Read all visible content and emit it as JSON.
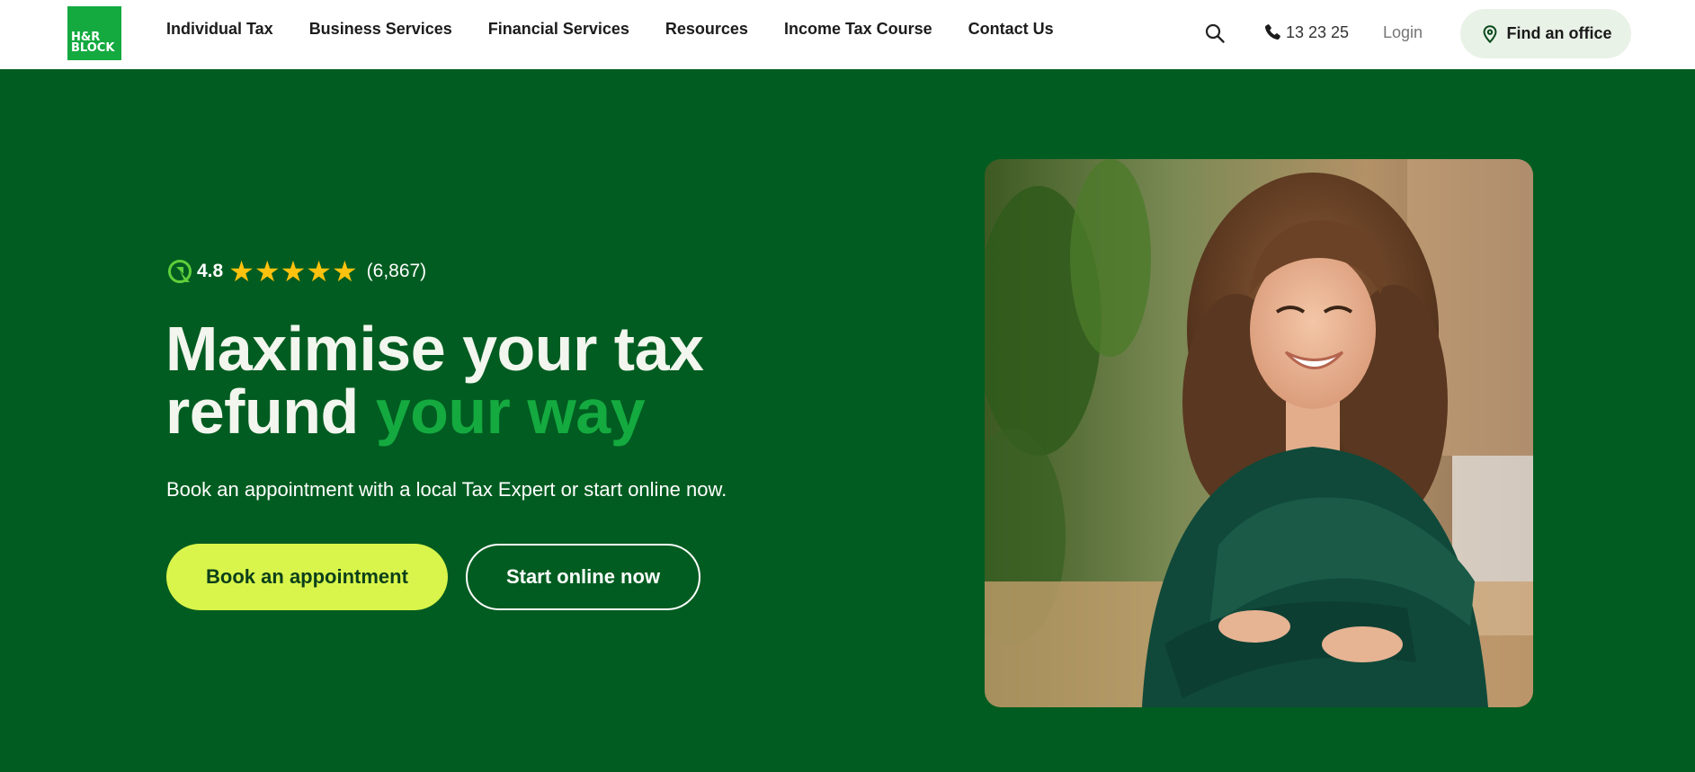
{
  "brand": {
    "logo_line1": "H&R",
    "logo_line2": "BLOCK",
    "accent_color": "#14aa40",
    "bg_color": "#005c20"
  },
  "nav": {
    "items": [
      {
        "label": "Individual Tax"
      },
      {
        "label": "Business Services"
      },
      {
        "label": "Financial Services"
      },
      {
        "label": "Resources"
      },
      {
        "label": "Income Tax Course"
      },
      {
        "label": "Contact Us"
      }
    ],
    "search_icon": "search-icon",
    "phone": "13 23 25",
    "login": "Login",
    "find_office": "Find an office"
  },
  "hero": {
    "rating": {
      "score": "4.8",
      "stars": 5,
      "count": "(6,867)"
    },
    "headline_part1": "Maximise your tax",
    "headline_part2": "refund ",
    "headline_accent": "your way",
    "subline": "Book an appointment with a local Tax Expert or start online now.",
    "primary_button": "Book an appointment",
    "secondary_button": "Start online now",
    "button_color": "#d9f54b"
  }
}
